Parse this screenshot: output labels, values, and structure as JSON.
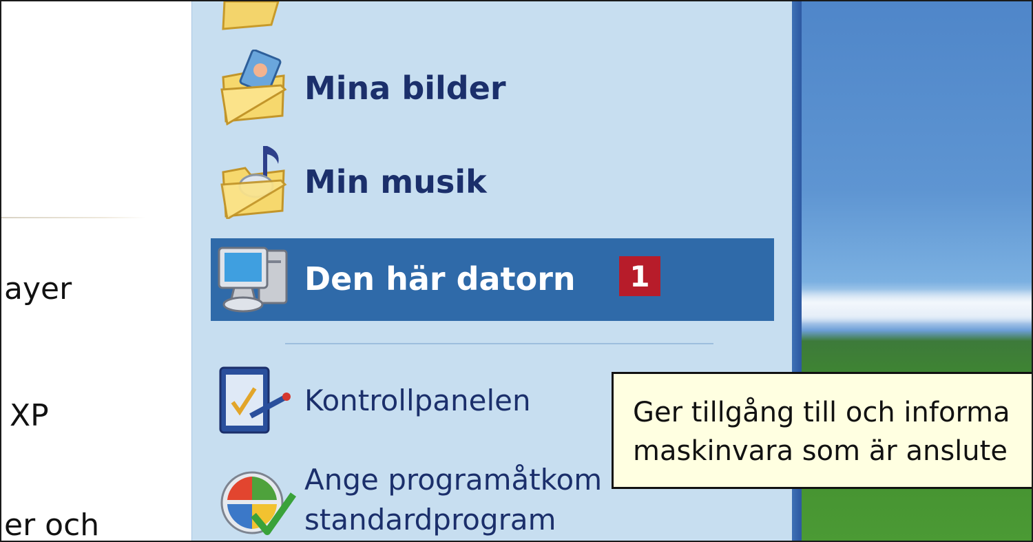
{
  "left_column": {
    "items": [
      {
        "text": "ayer"
      },
      {
        "text": "XP"
      },
      {
        "text": "er och"
      }
    ]
  },
  "start_menu": {
    "items": [
      {
        "label": "Mina bilder",
        "icon": "pictures-folder-icon"
      },
      {
        "label": "Min musik",
        "icon": "music-folder-icon"
      },
      {
        "label": "Den här datorn",
        "icon": "my-computer-icon",
        "selected": true,
        "badge": "1"
      },
      {
        "label": "Kontrollpanelen",
        "icon": "control-panel-icon"
      },
      {
        "label_line1": "Ange programåtkom",
        "label_line2": "standardprogram",
        "icon": "set-program-access-icon"
      }
    ]
  },
  "tooltip": {
    "line1": "Ger tillgång till och informa",
    "line2": "maskinvara som är anslute"
  },
  "colors": {
    "menu_bg": "#c7def0",
    "selection": "#2f6aa9",
    "badge": "#b71c2a",
    "tooltip_bg": "#ffffe1"
  }
}
